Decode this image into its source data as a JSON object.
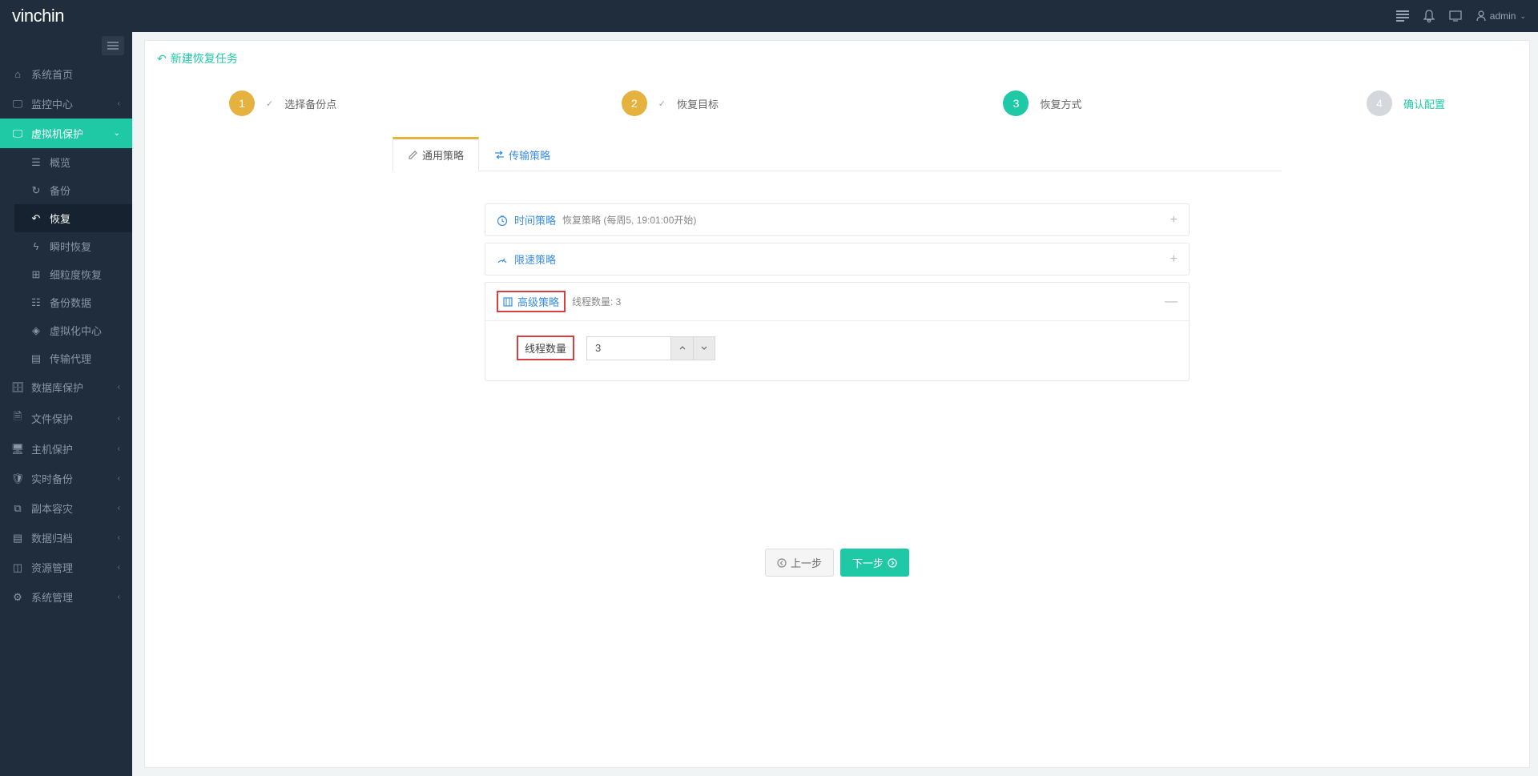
{
  "header": {
    "logo_part1": "vin",
    "logo_part2": "chin",
    "user": "admin"
  },
  "sidebar": {
    "items": [
      {
        "icon": "home",
        "label": "系统首页"
      },
      {
        "icon": "monitor",
        "label": "监控中心",
        "chevron": true
      },
      {
        "icon": "monitor",
        "label": "虚拟机保护",
        "chevron": true,
        "active": true
      },
      {
        "icon": "db",
        "label": "数据库保护",
        "chevron": true
      },
      {
        "icon": "file",
        "label": "文件保护",
        "chevron": true
      },
      {
        "icon": "host",
        "label": "主机保护",
        "chevron": true
      },
      {
        "icon": "shield",
        "label": "实时备份",
        "chevron": true
      },
      {
        "icon": "copy",
        "label": "副本容灾",
        "chevron": true
      },
      {
        "icon": "archive",
        "label": "数据归档",
        "chevron": true
      },
      {
        "icon": "resource",
        "label": "资源管理",
        "chevron": true
      },
      {
        "icon": "gear",
        "label": "系统管理",
        "chevron": true
      }
    ],
    "submenu": [
      {
        "label": "概览"
      },
      {
        "label": "备份"
      },
      {
        "label": "恢复",
        "active": true
      },
      {
        "label": "瞬时恢复"
      },
      {
        "label": "细粒度恢复"
      },
      {
        "label": "备份数据"
      },
      {
        "label": "虚拟化中心"
      },
      {
        "label": "传输代理"
      }
    ]
  },
  "page": {
    "title": "新建恢复任务"
  },
  "steps": {
    "step1": {
      "num": "1",
      "label": "选择备份点"
    },
    "step2": {
      "num": "2",
      "label": "恢复目标"
    },
    "step3": {
      "num": "3",
      "label": "恢复方式"
    },
    "step4": {
      "num": "4",
      "label": "确认配置"
    }
  },
  "tabs": {
    "general": "通用策略",
    "transfer": "传输策略"
  },
  "accordion": {
    "time": {
      "title": "时间策略",
      "subtitle": "恢复策略 (每周5, 19:01:00开始)"
    },
    "speed": {
      "title": "限速策略"
    },
    "advanced": {
      "title": "高级策略",
      "subtitle": "线程数量: 3"
    }
  },
  "form": {
    "thread_label": "线程数量",
    "thread_value": "3"
  },
  "buttons": {
    "prev": "上一步",
    "next": "下一步"
  }
}
